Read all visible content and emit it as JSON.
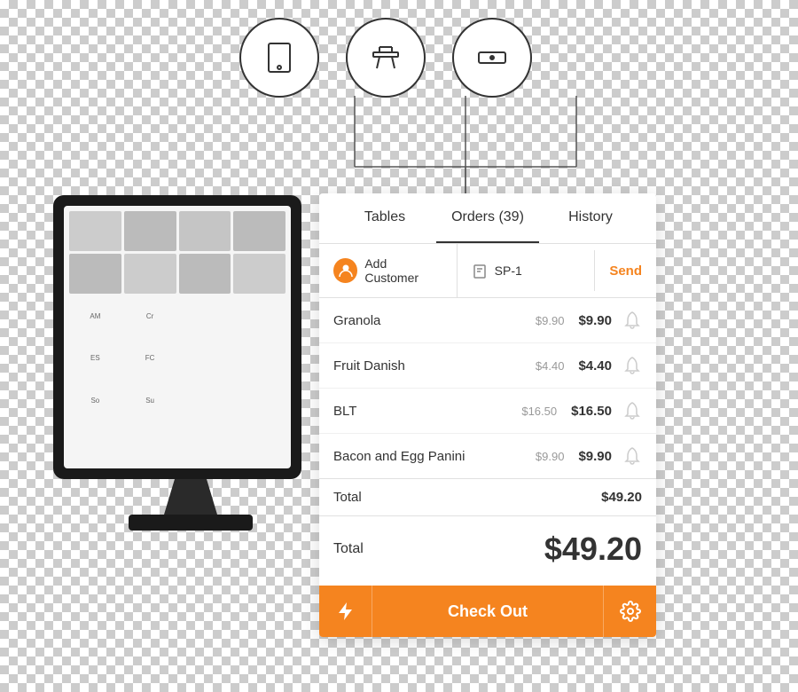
{
  "background": {
    "checker_color1": "#ffffff",
    "checker_color2": "#cccccc"
  },
  "icons": {
    "tablet_icon": "tablet-icon",
    "table_icon": "table-icon",
    "receipt_icon": "receipt-icon"
  },
  "tabs": {
    "tables": "Tables",
    "orders": "Orders (39)",
    "history": "History"
  },
  "order_bar": {
    "add_customer": "Add Customer",
    "order_id": "SP-1",
    "send_btn": "Send"
  },
  "items": [
    {
      "name": "Granola",
      "unit_price": "$9.90",
      "total_price": "$9.90"
    },
    {
      "name": "Fruit Danish",
      "unit_price": "$4.40",
      "total_price": "$4.40"
    },
    {
      "name": "BLT",
      "unit_price": "$16.50",
      "total_price": "$16.50"
    },
    {
      "name": "Bacon and Egg Panini",
      "unit_price": "$9.90",
      "total_price": "$9.90"
    }
  ],
  "subtotal": {
    "label": "Total",
    "value": "$49.20"
  },
  "total": {
    "label": "Total",
    "value": "$49.20"
  },
  "checkout": {
    "label": "Check Out"
  }
}
